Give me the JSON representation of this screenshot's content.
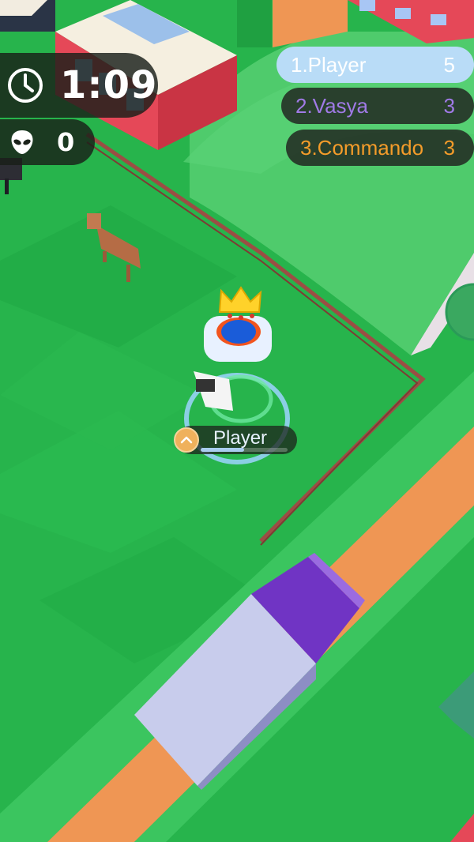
{
  "hud": {
    "timer": {
      "icon": "clock-icon",
      "value": "1:09"
    },
    "kills": {
      "icon": "alien-icon",
      "value": "0"
    }
  },
  "leaderboard": [
    {
      "rank_name": "1.Player",
      "score": "5",
      "color": "#ffffff",
      "background": "#b9dcf7"
    },
    {
      "rank_name": "2.Vasya",
      "score": "3",
      "color": "#a07ae6",
      "background": "#222822"
    },
    {
      "rank_name": "3.Commando",
      "score": "3",
      "color": "#f49c2a",
      "background": "#222822"
    }
  ],
  "player_tag": {
    "name": "Player",
    "level_icon": "chevron-up-icon",
    "progress": 0.5
  },
  "colors": {
    "grass": "#27b44c",
    "road": "#ef9654",
    "truck_cab": "#7034c4",
    "truck_trailer": "#c8ccec",
    "accent_gold": "#efb15c"
  }
}
